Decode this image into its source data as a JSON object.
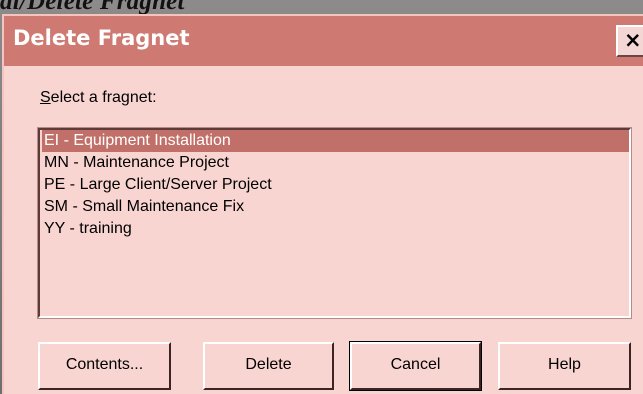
{
  "slide": {
    "heading": "al/Delete Fragnet"
  },
  "dialog": {
    "title": "Delete Fragnet",
    "close_glyph": "×",
    "select_label_mnemonic": "S",
    "select_label_rest": "elect a fragnet:",
    "items": [
      {
        "label": "EI - Equipment Installation",
        "selected": true
      },
      {
        "label": "MN - Maintenance Project",
        "selected": false
      },
      {
        "label": "PE - Large Client/Server Project",
        "selected": false
      },
      {
        "label": "SM - Small Maintenance Fix",
        "selected": false
      },
      {
        "label": "YY - training",
        "selected": false
      }
    ],
    "buttons": {
      "contents": "Contents...",
      "delete": "Delete",
      "cancel": "Cancel",
      "help": "Help"
    }
  },
  "colors": {
    "title_bar": "#ce7a72",
    "dialog_face": "#f9d5d2",
    "selection": "#c07068",
    "background": "#807d7d"
  },
  "icons": {
    "close": "close-icon"
  }
}
